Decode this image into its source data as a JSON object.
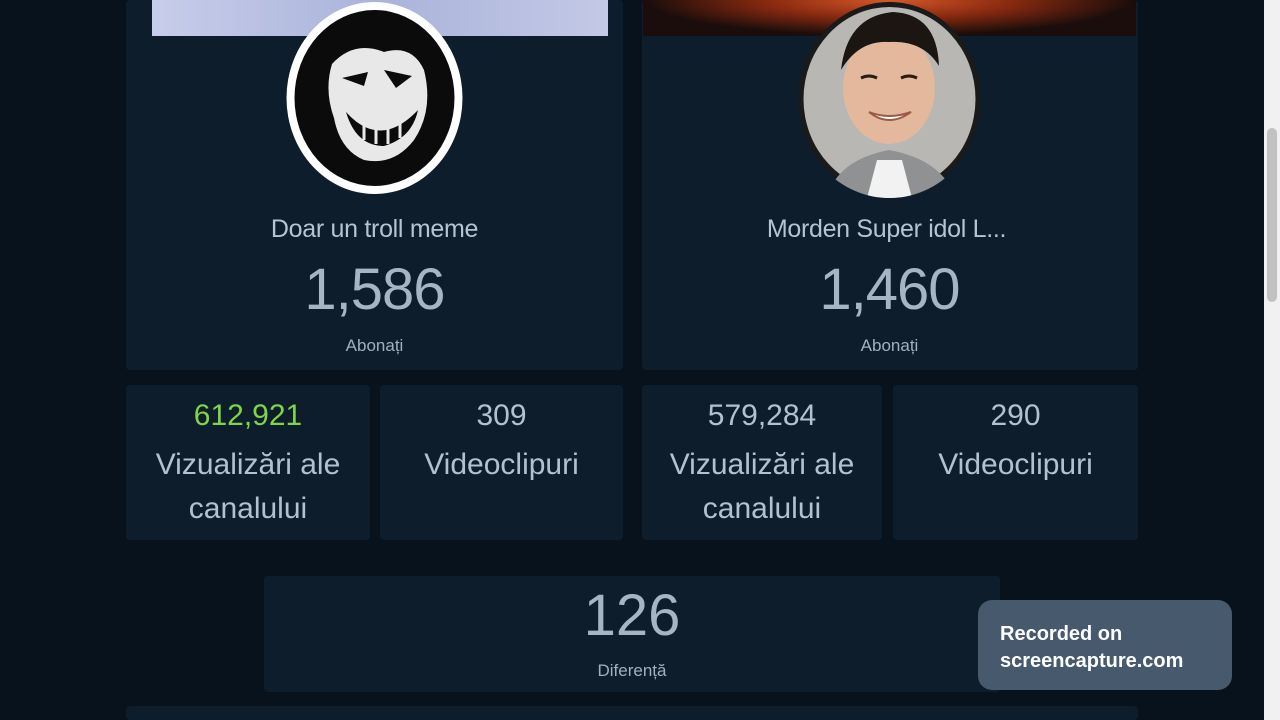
{
  "channels": [
    {
      "name": "Doar un troll meme",
      "subscribers": "1,586",
      "subscribers_label": "Abonați",
      "views": "612,921",
      "views_label": "Vizualizări ale canalului",
      "views_label_line1": "Vizualizări ale",
      "views_label_line2": "canalului",
      "videos": "309",
      "videos_label": "Videoclipuri",
      "avatar_icon": "troll-face-icon"
    },
    {
      "name": "Morden Super idol L...",
      "subscribers": "1,460",
      "subscribers_label": "Abonați",
      "views": "579,284",
      "views_label": "Vizualizări ale canalului",
      "views_label_line1": "Vizualizări ale",
      "views_label_line2": "canalului",
      "videos": "290",
      "videos_label": "Videoclipuri",
      "avatar_icon": "person-photo-icon"
    }
  ],
  "difference": {
    "value": "126",
    "label": "Diferență"
  },
  "watermark": {
    "line1": "Recorded on",
    "line2": "screencapture.com"
  },
  "colors": {
    "background": "#07121d",
    "panel": "#0e1d2b",
    "text": "#b3c1cf",
    "highlight_green": "#7fd448",
    "watermark": "#46596d"
  }
}
